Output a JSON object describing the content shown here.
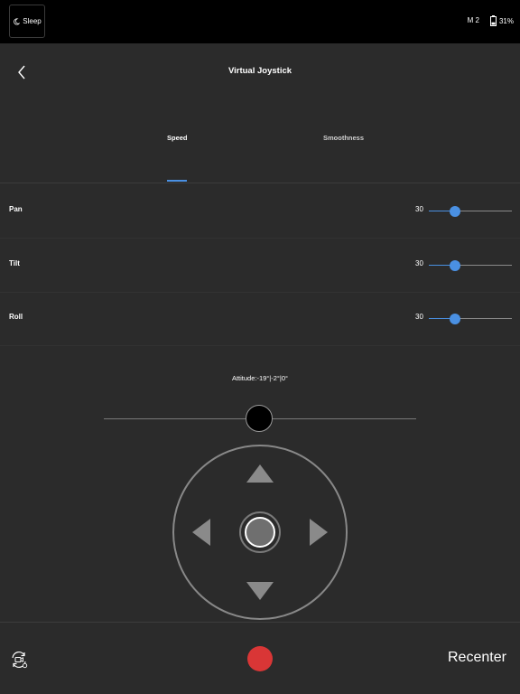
{
  "status_bar": {
    "sleep_label": "Sleep",
    "mode_label": "M 2",
    "battery_label": "31%",
    "battery_level": 31
  },
  "header": {
    "title": "Virtual Joystick",
    "back_icon": "chevron-left-icon"
  },
  "tabs": [
    {
      "label": "Speed",
      "active": true
    },
    {
      "label": "Smoothness",
      "active": false
    }
  ],
  "settings": [
    {
      "label": "Pan",
      "value": "30",
      "fraction": 0.32
    },
    {
      "label": "Tilt",
      "value": "30",
      "fraction": 0.32
    },
    {
      "label": "Roll",
      "value": "30",
      "fraction": 0.32
    }
  ],
  "attitude": {
    "text": "Attitude:-19°|-2°|0°"
  },
  "bottom_bar": {
    "recenter_label": "Recenter",
    "record_color": "#d93636",
    "switch_icon": "camera-switch-icon"
  },
  "colors": {
    "accent": "#4a90e2",
    "background": "#2b2b2b",
    "topbar": "#000000"
  }
}
